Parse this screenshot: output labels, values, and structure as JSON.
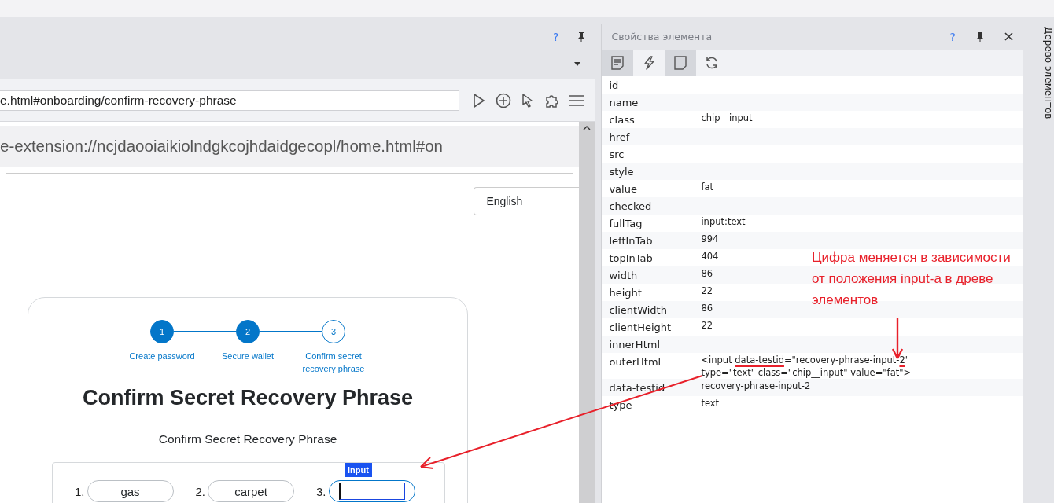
{
  "browser_panel": {
    "help": "?",
    "address": "e.html#onboarding/confirm-recovery-phrase",
    "page_url": "e-extension://ncjdaooiaikiolndgkcojhdaidgecopl/home.html#on"
  },
  "page": {
    "language": "English",
    "steps": [
      {
        "number": "1",
        "label": "Create password",
        "done": true
      },
      {
        "number": "2",
        "label": "Secure wallet",
        "done": true
      },
      {
        "number": "3",
        "label": "Confirm secret recovery phrase",
        "done": false
      }
    ],
    "title": "Confirm Secret Recovery Phrase",
    "subtitle": "Confirm Secret Recovery Phrase",
    "words": [
      {
        "index": "1.",
        "value": "gas",
        "highlighted": false
      },
      {
        "index": "2.",
        "value": "carpet",
        "highlighted": false
      },
      {
        "index": "3.",
        "highlighted": true
      }
    ],
    "highlight_tag": "input"
  },
  "properties_panel": {
    "title": "Свойства элемента",
    "help": "?",
    "tools": [
      {
        "kind": "document",
        "on": true
      },
      {
        "kind": "lightning",
        "on": false
      },
      {
        "kind": "page",
        "on": true
      },
      {
        "kind": "refresh",
        "on": false
      }
    ],
    "rows": [
      {
        "key": "id"
      },
      {
        "key": "name"
      },
      {
        "key": "class",
        "value": "chip__input"
      },
      {
        "key": "href"
      },
      {
        "key": "src"
      },
      {
        "key": "style"
      },
      {
        "key": "value",
        "value": "fat"
      },
      {
        "key": "checked"
      },
      {
        "key": "fullTag",
        "value": "input:text"
      },
      {
        "key": "leftInTab",
        "value": "994"
      },
      {
        "key": "topInTab",
        "value": "404"
      },
      {
        "key": "width",
        "value": "86"
      },
      {
        "key": "height",
        "value": "22"
      },
      {
        "key": "clientWidth",
        "value": "86"
      },
      {
        "key": "clientHeight",
        "value": "22"
      },
      {
        "key": "innerHtml"
      },
      {
        "key": "outerHtml",
        "parts": [
          {
            "text": "<input ",
            "underlined": false
          },
          {
            "text": "data-testid",
            "underlined": true
          },
          {
            "text": "=\"recovery-phrase-input-",
            "underlined": false
          },
          {
            "text": "2",
            "underlined": true
          },
          {
            "text": "\" type=\"text\" class=\"chip__input\" value=\"fat\">",
            "underlined": false
          }
        ]
      },
      {
        "key": "data-testid",
        "value": "recovery-phrase-input-2"
      },
      {
        "key": "type",
        "value": "text"
      }
    ]
  },
  "side_tab": "Дерево элементов",
  "annotation": {
    "note": "Цифра меняется в зависимости от положения input-а в древе элементов"
  }
}
